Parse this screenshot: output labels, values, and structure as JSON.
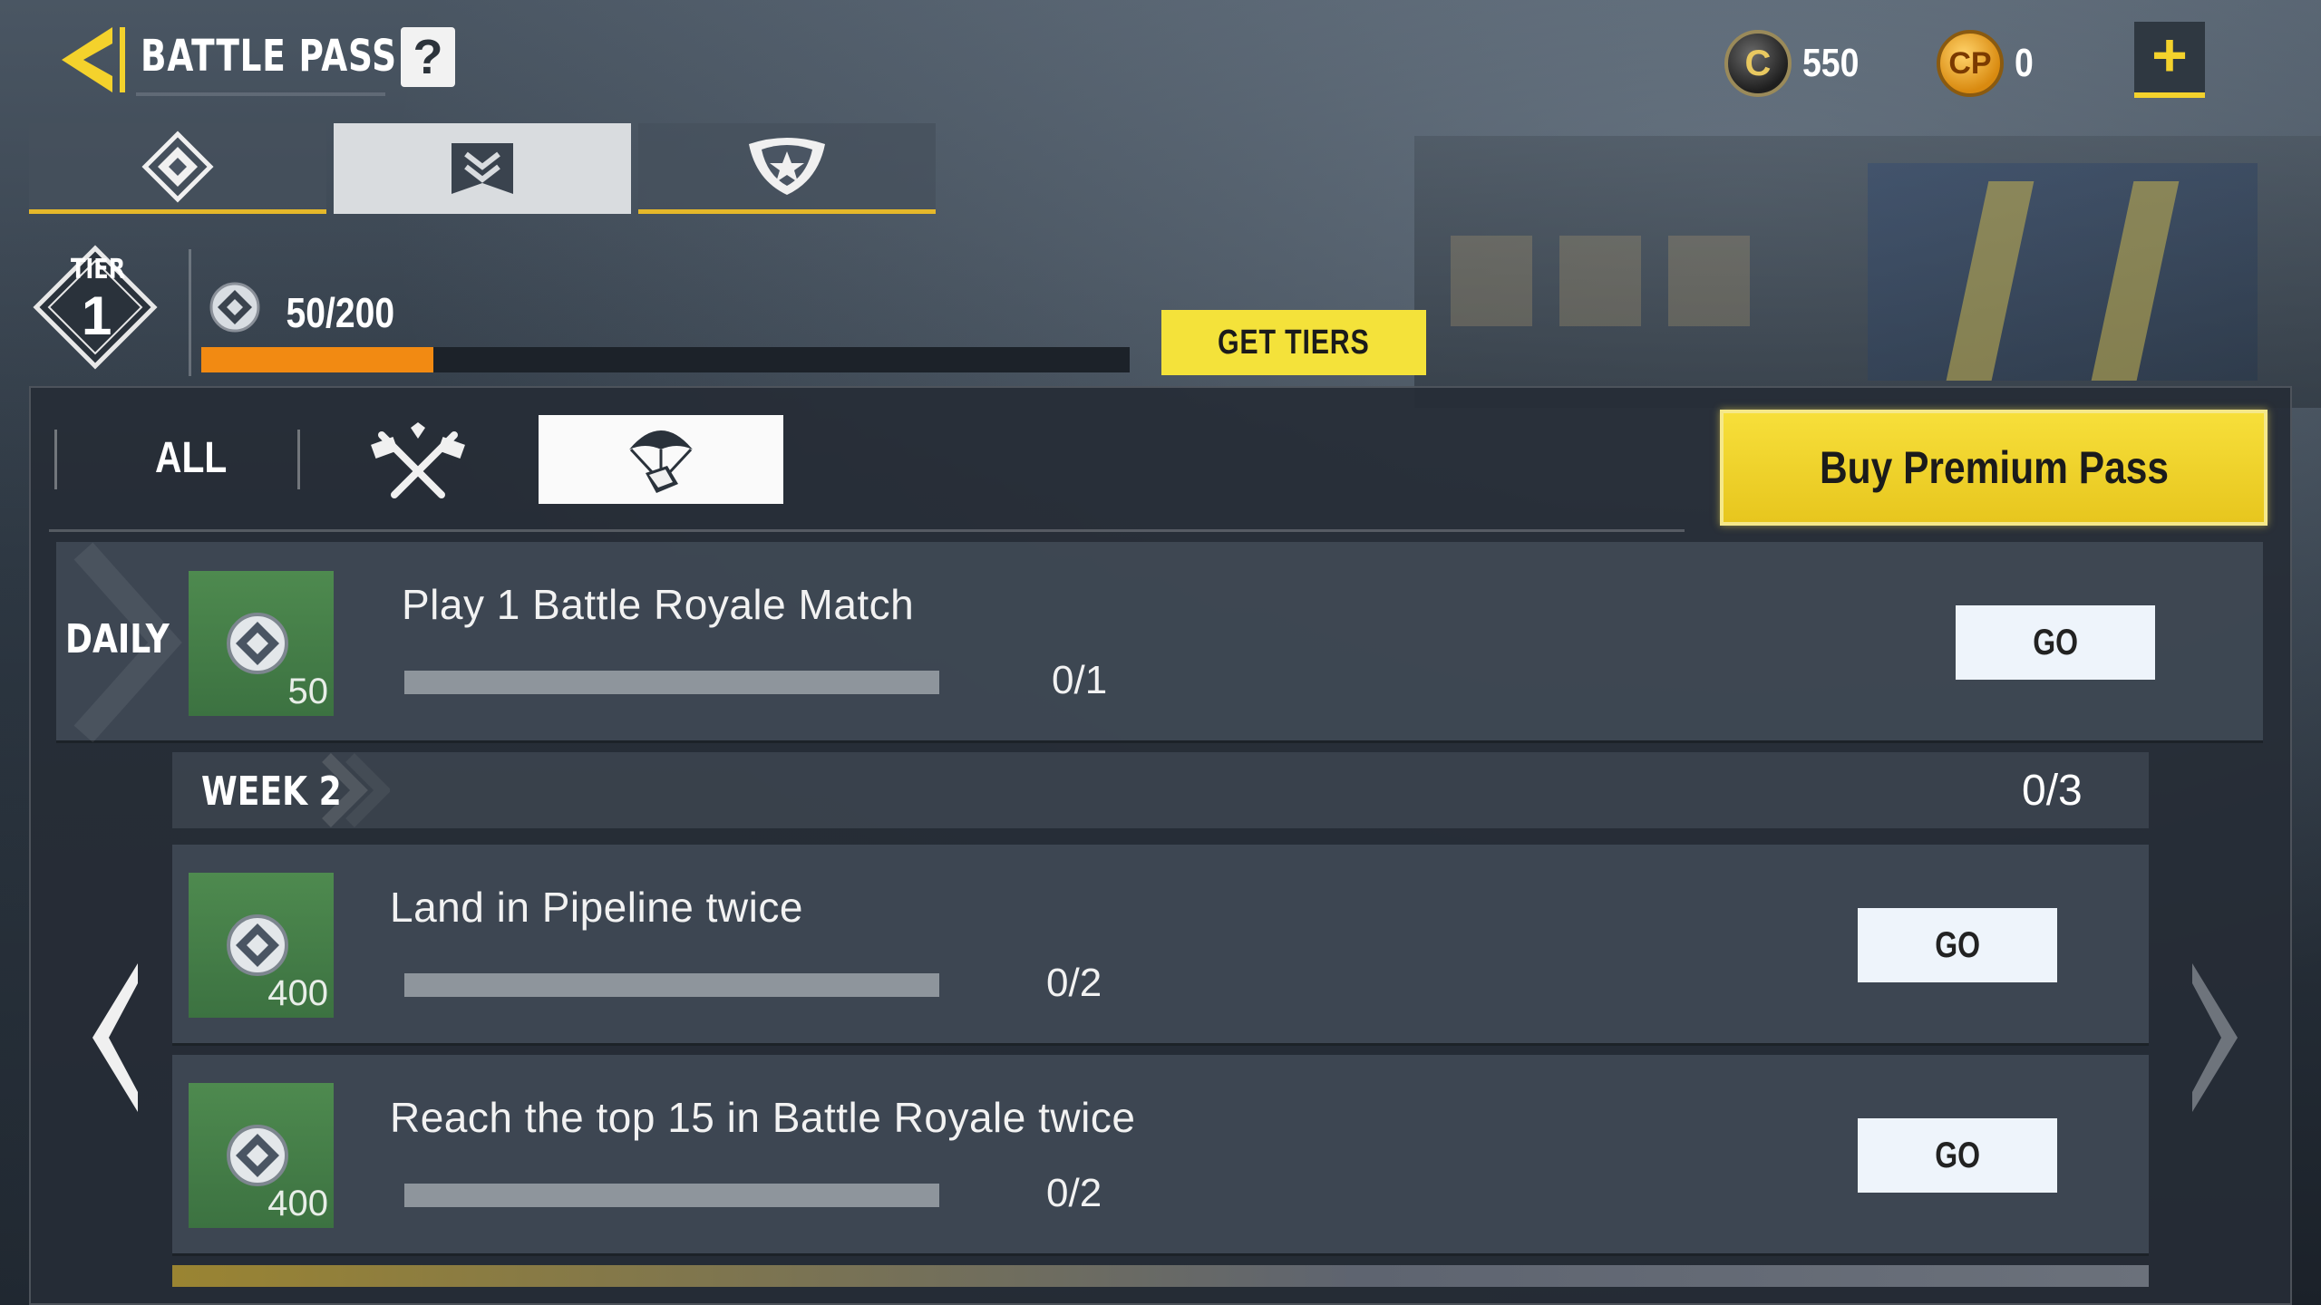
{
  "header": {
    "title": "BATTLE PASS",
    "help_label": "?",
    "back_icon": "back-arrow-icon"
  },
  "currency": {
    "cod_points_symbol": "C",
    "cod_points_value": "550",
    "cp_symbol": "CP",
    "cp_value": "0",
    "add_label": "+"
  },
  "tabs": [
    {
      "icon": "diamond-emblem-icon",
      "active": false
    },
    {
      "icon": "battle-pass-banner-icon",
      "active": true
    },
    {
      "icon": "star-shield-icon",
      "active": false
    }
  ],
  "tier": {
    "label": "TIER",
    "level": "1",
    "xp_text": "50/200",
    "xp_fraction": 0.25,
    "get_tiers_label": "GET TIERS"
  },
  "filters": {
    "all_label": "ALL",
    "multiplayer_icon": "crossed-guns-icon",
    "battle_royale_icon": "parachute-crate-icon",
    "active": "battle_royale"
  },
  "buy_premium_label": "Buy Premium Pass",
  "daily": {
    "label": "DAILY",
    "reward": "50",
    "text": "Play 1 Battle Royale Match",
    "progress": "0/1",
    "progress_fraction": 0,
    "go_label": "GO"
  },
  "week": {
    "label": "WEEK 2",
    "progress": "0/3",
    "missions": [
      {
        "reward": "400",
        "text": "Land in Pipeline twice",
        "progress": "0/2",
        "progress_fraction": 0,
        "go_label": "GO"
      },
      {
        "reward": "400",
        "text": "Reach the top 15 in Battle Royale twice",
        "progress": "0/2",
        "progress_fraction": 0,
        "go_label": "GO"
      }
    ]
  },
  "colors": {
    "accent_yellow": "#f4e23a",
    "xp_orange": "#f28a12",
    "reward_green": "#4e8a4f",
    "tab_underline": "#e5b82a"
  }
}
